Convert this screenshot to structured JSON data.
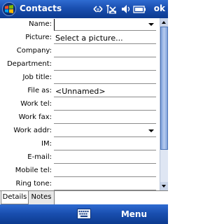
{
  "titlebar": {
    "title": "Contacts",
    "ok_label": "ok",
    "tray_icons": [
      "connectivity-icon",
      "signal-off-icon",
      "speaker-icon",
      "battery-icon"
    ]
  },
  "form": {
    "fields": [
      {
        "label": "Name:",
        "value": "",
        "dropdown": true,
        "focused": true
      },
      {
        "label": "Picture:",
        "value": "Select a picture...",
        "dropdown": false
      },
      {
        "label": "Company:",
        "value": "",
        "dropdown": false
      },
      {
        "label": "Department:",
        "value": "",
        "dropdown": false
      },
      {
        "label": "Job title:",
        "value": "",
        "dropdown": false
      },
      {
        "label": "File as:",
        "value": "<Unnamed>",
        "dropdown": false
      },
      {
        "label": "Work tel:",
        "value": "",
        "dropdown": false
      },
      {
        "label": "Work fax:",
        "value": "",
        "dropdown": false
      },
      {
        "label": "Work addr:",
        "value": "",
        "dropdown": true
      },
      {
        "label": "IM:",
        "value": "",
        "dropdown": false
      },
      {
        "label": "E-mail:",
        "value": "",
        "dropdown": false
      },
      {
        "label": "Mobile tel:",
        "value": "",
        "dropdown": false
      },
      {
        "label": "Ring tone:",
        "value": "",
        "dropdown": false
      }
    ]
  },
  "tabs": [
    {
      "label": "Details",
      "active": true
    },
    {
      "label": "Notes",
      "active": false
    }
  ],
  "menubar": {
    "menu_label": "Menu",
    "keyboard_icon": "keyboard-icon"
  },
  "colors": {
    "bar_blue": "#1a4fb0",
    "field_line": "#8c8c8c"
  }
}
